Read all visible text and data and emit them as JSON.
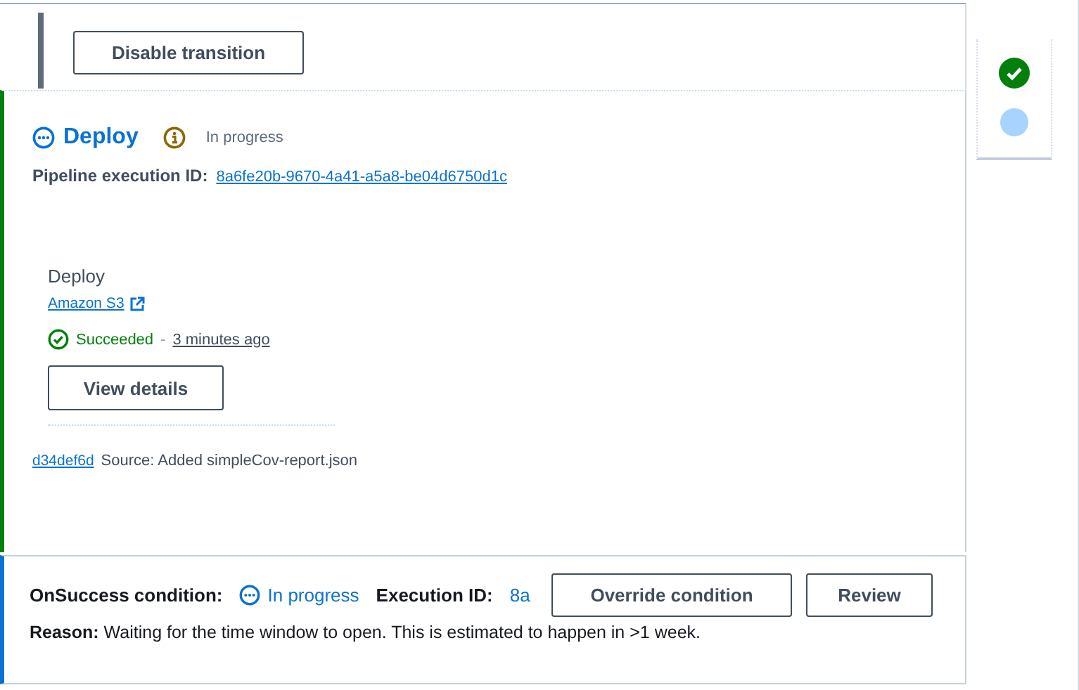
{
  "transition": {
    "button": "Disable transition"
  },
  "stage": {
    "name": "Deploy",
    "kind": "in_progress",
    "status": "In progress",
    "execution_label": "Pipeline execution ID:",
    "execution_id": "8a6fe20b-9670-4a41-a5a8-be04d6750d1c",
    "action": {
      "name": "Deploy",
      "provider": "Amazon S3",
      "kind": "succeeded",
      "status": "Succeeded",
      "separator": "-",
      "time": "3 minutes ago",
      "button": "View details"
    },
    "commit": {
      "id": "d34def6d",
      "message": "Source: Added simpleCov-report.json"
    }
  },
  "condition": {
    "label": "OnSuccess condition:",
    "kind": "in_progress",
    "status": "In progress",
    "execution_label": "Execution ID:",
    "execution_id": "8a",
    "reason_label": "Reason:",
    "reason": "Waiting for the time window to open. This is estimated to happen in >1 week.",
    "buttons": [
      "Override condition",
      "Review"
    ]
  },
  "stage_indicators": [
    {
      "kind": "succeeded"
    },
    {
      "kind": "in_progress"
    }
  ]
}
